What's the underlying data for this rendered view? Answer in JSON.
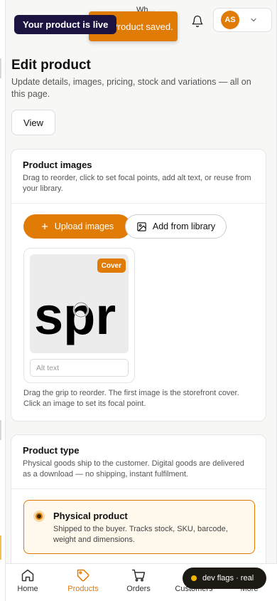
{
  "toasts": {
    "live": "Your product is live",
    "saved": "Product saved.",
    "peek": "Wh..."
  },
  "user": {
    "initials": "AS"
  },
  "page": {
    "title": "Edit product",
    "subtitle": "Update details, images, pricing, stock and variations — all on this page.",
    "view_label": "View"
  },
  "images": {
    "title": "Product images",
    "description": "Drag to reorder, click to set focal points, add alt text, or reuse from your library.",
    "upload_label": "Upload images",
    "library_label": "Add from library",
    "cover_badge": "Cover",
    "thumb_text": "spr",
    "alt_placeholder": "Alt text",
    "hint": "Drag the grip to reorder. The first image is the storefront cover. Click an image to set its focal point."
  },
  "product_type": {
    "title": "Product type",
    "description": "Physical goods ship to the customer. Digital goods are delivered as a download — no shipping, instant fulfilment.",
    "selected_option": {
      "title": "Physical product",
      "description": "Shipped to the buyer. Tracks stock, SKU, barcode, weight and dimensions."
    }
  },
  "nav": {
    "items": [
      {
        "label": "Home",
        "icon": "home-icon"
      },
      {
        "label": "Products",
        "icon": "tag-icon"
      },
      {
        "label": "Orders",
        "icon": "cart-icon"
      },
      {
        "label": "Customers",
        "icon": "users-icon"
      },
      {
        "label": "More",
        "icon": "more-icon"
      }
    ],
    "active": "Products"
  },
  "dev": {
    "label": "dev flags · real"
  },
  "colors": {
    "accent": "#e07b06",
    "dark": "#1d1340"
  }
}
